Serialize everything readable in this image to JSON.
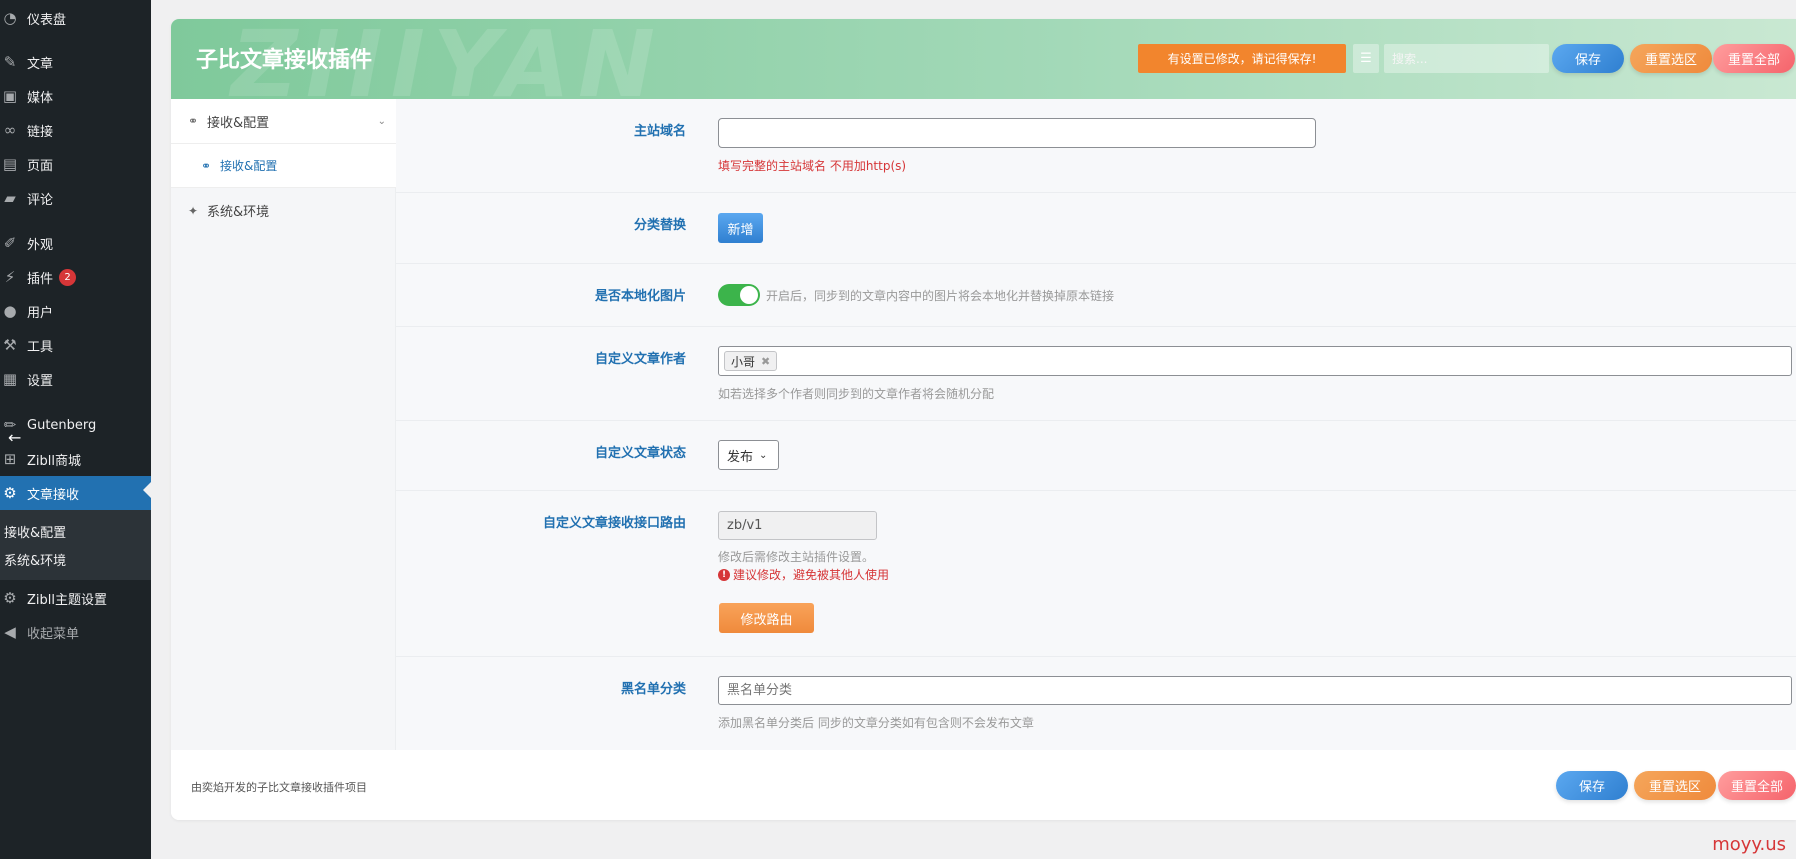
{
  "wp_menu": {
    "dashboard": "仪表盘",
    "posts": "文章",
    "media": "媒体",
    "links": "链接",
    "pages": "页面",
    "comments": "评论",
    "appearance": "外观",
    "plugins": "插件",
    "plugins_badge": "2",
    "users": "用户",
    "tools": "工具",
    "settings": "设置",
    "gutenberg": "Gutenberg",
    "zibll_shop": "Zibll商城",
    "article_receive": "文章接收",
    "submenu": [
      "接收&配置",
      "系统&环境"
    ],
    "zibll_theme_settings": "Zibll主题设置",
    "collapse_menu": "收起菜单"
  },
  "header": {
    "title": "子比文章接收插件",
    "watermark": "ZHIYAN",
    "notice": "有设置已修改，请记得保存!",
    "search_placeholder": "搜索...",
    "save": "保存",
    "reset_section": "重置选区",
    "reset_all": "重置全部"
  },
  "nav": {
    "section": "接收&配置",
    "sub_item": "接收&配置",
    "env": "系统&环境"
  },
  "fields": {
    "main_domain": {
      "label": "主站域名",
      "value": "",
      "help": "填写完整的主站域名 不用加http(s)"
    },
    "category_replace": {
      "label": "分类替换",
      "button": "新增"
    },
    "localize_images": {
      "label": "是否本地化图片",
      "on": true,
      "help": "开启后，同步到的文章内容中的图片将会本地化并替换掉原本链接"
    },
    "custom_author": {
      "label": "自定义文章作者",
      "tags": [
        "小哥"
      ],
      "help": "如若选择多个作者则同步到的文章作者将会随机分配"
    },
    "custom_status": {
      "label": "自定义文章状态",
      "value": "发布"
    },
    "custom_route": {
      "label": "自定义文章接收接口路由",
      "value": "zb/v1",
      "help1": "修改后需修改主站插件设置。",
      "help2": "建议修改，避免被其他人使用",
      "button": "修改路由"
    },
    "blacklist": {
      "label": "黑名单分类",
      "placeholder": "黑名单分类",
      "help": "添加黑名单分类后 同步的文章分类如有包含则不会发布文章"
    }
  },
  "footer": {
    "note": "由奕焰开发的子比文章接收插件项目",
    "save": "保存",
    "reset_section": "重置选区",
    "reset_all": "重置全部"
  },
  "watermark": "moyy.us"
}
